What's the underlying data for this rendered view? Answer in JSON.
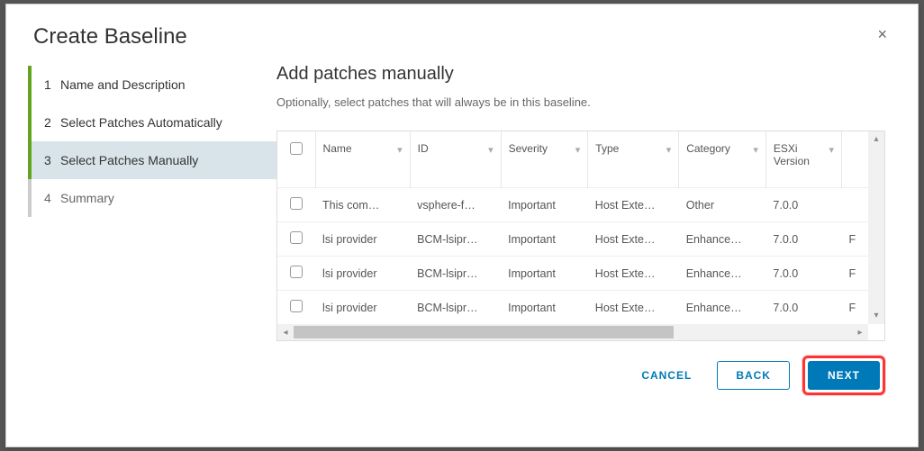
{
  "modal": {
    "title": "Create Baseline",
    "close_label": "×"
  },
  "wizard": {
    "steps": [
      {
        "num": "1",
        "label": "Name and Description",
        "state": "completed"
      },
      {
        "num": "2",
        "label": "Select Patches Automatically",
        "state": "completed"
      },
      {
        "num": "3",
        "label": "Select Patches Manually",
        "state": "active"
      },
      {
        "num": "4",
        "label": "Summary",
        "state": "pending"
      }
    ]
  },
  "section": {
    "title": "Add patches manually",
    "subtitle": "Optionally, select patches that will always be in this baseline."
  },
  "table": {
    "columns": {
      "name": "Name",
      "id": "ID",
      "severity": "Severity",
      "type": "Type",
      "category": "Category",
      "esxi_version": "ESXi Version"
    },
    "rows": [
      {
        "name": "This com…",
        "id": "vsphere-f…",
        "severity": "Important",
        "type": "Host Exte…",
        "category": "Other",
        "esxi_version": "7.0.0",
        "extra": ""
      },
      {
        "name": "lsi provider",
        "id": "BCM-lsipr…",
        "severity": "Important",
        "type": "Host Exte…",
        "category": "Enhance…",
        "esxi_version": "7.0.0",
        "extra": "F"
      },
      {
        "name": "lsi provider",
        "id": "BCM-lsipr…",
        "severity": "Important",
        "type": "Host Exte…",
        "category": "Enhance…",
        "esxi_version": "7.0.0",
        "extra": "F"
      },
      {
        "name": "lsi provider",
        "id": "BCM-lsipr…",
        "severity": "Important",
        "type": "Host Exte…",
        "category": "Enhance…",
        "esxi_version": "7.0.0",
        "extra": "F"
      }
    ]
  },
  "footer": {
    "cancel": "CANCEL",
    "back": "BACK",
    "next": "NEXT"
  }
}
